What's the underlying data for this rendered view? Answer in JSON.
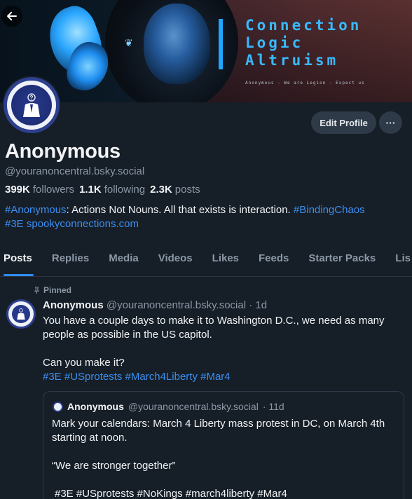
{
  "banner": {
    "line1": "Connection",
    "line2": "Logic",
    "line3": "Altruism",
    "small": "Anonymous - We are Legion - Expect us"
  },
  "profile": {
    "display_name": "Anonymous",
    "handle": "@youranoncentral.bsky.social",
    "followers_count": "399K",
    "followers_label": "followers",
    "following_count": "1.1K",
    "following_label": "following",
    "posts_count": "2.3K",
    "posts_label": "posts",
    "edit_label": "Edit Profile",
    "more_label": "···",
    "bio": {
      "tag1": "#Anonymous",
      "text1": ": Actions Not Nouns. All that exists is interaction. ",
      "tag2": "#BindingChaos",
      "tag3": "#3E",
      "link": "spookyconnections.com"
    }
  },
  "tabs": [
    {
      "label": "Posts"
    },
    {
      "label": "Replies"
    },
    {
      "label": "Media"
    },
    {
      "label": "Videos"
    },
    {
      "label": "Likes"
    },
    {
      "label": "Feeds"
    },
    {
      "label": "Starter Packs"
    },
    {
      "label": "Lis"
    }
  ],
  "post": {
    "pinned_label": "Pinned",
    "author": "Anonymous",
    "handle": "@youranoncentral.bsky.social",
    "time": "· 1d",
    "line1": "You have a couple days to make it to Washington D.C., we need as many people as possible in the US capitol.",
    "line2": "Can you make it?",
    "tags": "#3E #USprotests #March4Liberty #Mar4",
    "quote": {
      "author": "Anonymous",
      "handle": "@youranoncentral.bsky.social",
      "time": "· 11d",
      "line1": "Mark your calendars: March 4 Liberty mass protest in DC, on March 4th starting at noon.",
      "line2": "“We are stronger together”",
      "tags": "#3E #USprotests #NoKings #march4liberty #Mar4"
    }
  },
  "colors": {
    "background": "#161e27",
    "accent": "#2f8cf6",
    "link": "#3b8ef0",
    "muted": "#8b98a6"
  }
}
